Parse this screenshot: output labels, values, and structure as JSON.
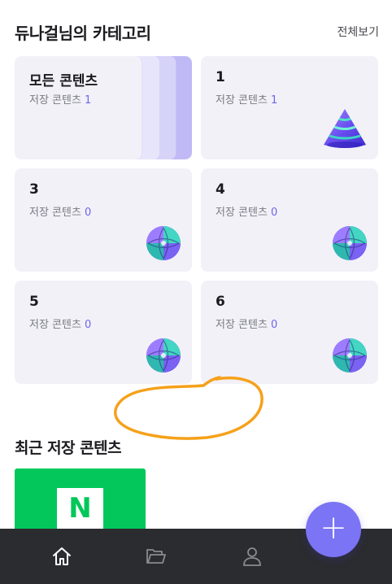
{
  "header": {
    "title": "듀나걸님의 카테고리",
    "view_all": "전체보기"
  },
  "count_label": "저장 콘텐츠",
  "categories": [
    {
      "name": "모든 콘텐츠",
      "count": "1",
      "art": "stack"
    },
    {
      "name": "1",
      "count": "1",
      "art": "cone-icon"
    },
    {
      "name": "3",
      "count": "0",
      "art": "sphere-icon"
    },
    {
      "name": "4",
      "count": "0",
      "art": "sphere-icon"
    },
    {
      "name": "5",
      "count": "0",
      "art": "sphere-icon"
    },
    {
      "name": "6",
      "count": "0",
      "art": "sphere-icon"
    }
  ],
  "recent": {
    "title": "최근 저장 콘텐츠",
    "thumb_letter": "N"
  },
  "colors": {
    "accent": "#7b74f5",
    "card_bg": "#f2f1f8",
    "count": "#6e66e8",
    "annotation": "#f5a11a",
    "naver": "#03c75a",
    "nav_bg": "#2b2c2f"
  },
  "nav": [
    "home-icon",
    "folder-icon",
    "profile-icon"
  ],
  "fab": {
    "icon": "plus-icon"
  }
}
